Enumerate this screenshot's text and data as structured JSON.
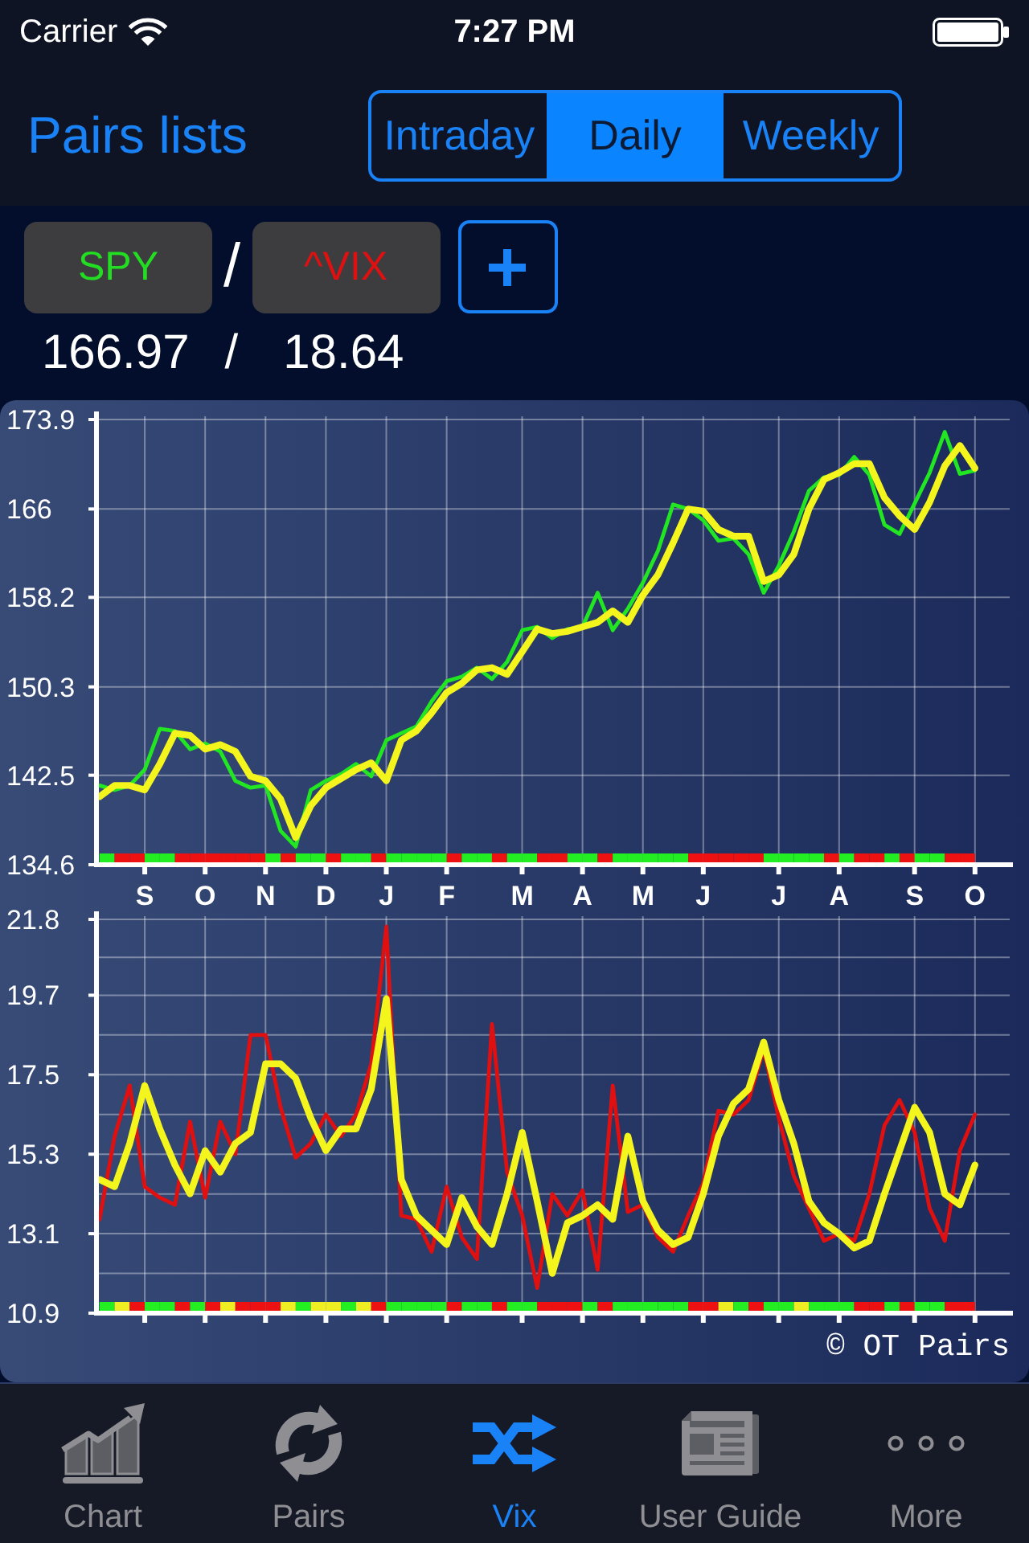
{
  "status_bar": {
    "carrier": "Carrier",
    "time": "7:27 PM"
  },
  "nav_bar": {
    "title": "Pairs lists",
    "segments": [
      {
        "label": "Intraday",
        "selected": false
      },
      {
        "label": "Daily",
        "selected": true
      },
      {
        "label": "Weekly",
        "selected": false
      }
    ]
  },
  "pair": {
    "symbols": [
      {
        "label": "SPY",
        "color": "#22dd22"
      },
      {
        "label": "^VIX",
        "color": "#e01010"
      }
    ],
    "separator": "/",
    "prices": [
      "166.97",
      "18.64"
    ],
    "price_separator": "/"
  },
  "charts": [
    {
      "chart_data": {
        "type": "line",
        "grid": true,
        "categories": [
          null,
          null,
          null,
          "S",
          null,
          null,
          null,
          "O",
          null,
          null,
          null,
          "N",
          null,
          null,
          null,
          "D",
          null,
          null,
          null,
          "J",
          null,
          null,
          null,
          "F",
          null,
          null,
          null,
          null,
          "M",
          null,
          null,
          null,
          "A",
          null,
          null,
          null,
          "M",
          null,
          null,
          null,
          "J",
          null,
          null,
          null,
          null,
          "J",
          null,
          null,
          null,
          "A",
          null,
          null,
          null,
          null,
          "S",
          null,
          null,
          null,
          "O"
        ],
        "ylim": [
          134.6,
          173.9
        ],
        "yticks": [
          134.6,
          142.5,
          150.3,
          158.2,
          166,
          173.9
        ],
        "series": [
          {
            "color": "#22e622",
            "values": [
              141.6,
              141.2,
              141.6,
              143.0,
              146.6,
              146.4,
              144.8,
              145.3,
              144.6,
              142.0,
              141.4,
              141.6,
              137.6,
              136.2,
              141.2,
              142.0,
              142.6,
              143.5,
              142.4,
              145.6,
              146.2,
              146.8,
              149.0,
              150.8,
              151.2,
              152.0,
              151.0,
              152.5,
              155.3,
              155.6,
              154.6,
              155.4,
              155.6,
              158.6,
              155.3,
              157.2,
              159.5,
              162.3,
              166.4,
              166.0,
              165.0,
              163.2,
              163.4,
              162.0,
              158.6,
              161.0,
              164.0,
              167.6,
              168.8,
              169.0,
              170.6,
              169.0,
              164.6,
              163.8,
              166.5,
              169.2,
              172.8,
              169.1,
              169.4
            ]
          },
          {
            "color": "#f5f51e",
            "values": [
              140.6,
              141.6,
              141.6,
              141.2,
              143.5,
              146.2,
              146.0,
              144.8,
              145.2,
              144.6,
              142.4,
              142.0,
              140.4,
              137.0,
              139.8,
              141.4,
              142.2,
              143.0,
              143.6,
              142.0,
              145.6,
              146.4,
              148.0,
              149.8,
              150.6,
              151.8,
              152.0,
              151.4,
              153.4,
              155.4,
              155.0,
              155.2,
              155.6,
              156.0,
              157.0,
              156.0,
              158.4,
              160.2,
              163.0,
              166.0,
              165.8,
              164.2,
              163.6,
              163.6,
              159.6,
              160.2,
              162.0,
              166.0,
              168.6,
              169.2,
              170.0,
              170.0,
              167.0,
              165.4,
              164.2,
              166.6,
              169.8,
              171.6,
              169.6
            ]
          }
        ]
      },
      "signal_strip": [
        {
          "color": "#22ee22"
        },
        {
          "color": "#ee1111"
        },
        {
          "color": "#ee1111"
        },
        {
          "color": "#22ee22"
        },
        {
          "color": "#22ee22"
        },
        {
          "color": "#ee1111"
        },
        {
          "color": "#ee1111"
        },
        {
          "color": "#ee1111"
        },
        {
          "color": "#ee1111"
        },
        {
          "color": "#ee1111"
        },
        {
          "color": "#ee1111"
        },
        {
          "color": "#22ee22"
        },
        {
          "color": "#ee1111"
        },
        {
          "color": "#22ee22"
        },
        {
          "color": "#22ee22"
        },
        {
          "color": "#ee1111"
        },
        {
          "color": "#22ee22"
        },
        {
          "color": "#22ee22"
        },
        {
          "color": "#ee1111"
        },
        {
          "color": "#22ee22"
        },
        {
          "color": "#22ee22"
        },
        {
          "color": "#22ee22"
        },
        {
          "color": "#22ee22"
        },
        {
          "color": "#ee1111"
        },
        {
          "color": "#22ee22"
        },
        {
          "color": "#22ee22"
        },
        {
          "color": "#ee1111"
        },
        {
          "color": "#22ee22"
        },
        {
          "color": "#22ee22"
        },
        {
          "color": "#ee1111"
        },
        {
          "color": "#ee1111"
        },
        {
          "color": "#22ee22"
        },
        {
          "color": "#22ee22"
        },
        {
          "color": "#ee1111"
        },
        {
          "color": "#22ee22"
        },
        {
          "color": "#22ee22"
        },
        {
          "color": "#22ee22"
        },
        {
          "color": "#22ee22"
        },
        {
          "color": "#22ee22"
        },
        {
          "color": "#ee1111"
        },
        {
          "color": "#ee1111"
        },
        {
          "color": "#ee1111"
        },
        {
          "color": "#ee1111"
        },
        {
          "color": "#ee1111"
        },
        {
          "color": "#22ee22"
        },
        {
          "color": "#22ee22"
        },
        {
          "color": "#22ee22"
        },
        {
          "color": "#22ee22"
        },
        {
          "color": "#ee1111"
        },
        {
          "color": "#22ee22"
        },
        {
          "color": "#ee1111"
        },
        {
          "color": "#ee1111"
        },
        {
          "color": "#22ee22"
        },
        {
          "color": "#ee1111"
        },
        {
          "color": "#22ee22"
        },
        {
          "color": "#22ee22"
        },
        {
          "color": "#ee1111"
        },
        {
          "color": "#ee1111"
        }
      ]
    },
    {
      "chart_data": {
        "type": "line",
        "grid": true,
        "ylim": [
          10.9,
          21.8
        ],
        "yticks": [
          10.9,
          13.1,
          15.3,
          17.5,
          19.7,
          21.8
        ],
        "series": [
          {
            "color": "#e01010",
            "values": [
              13.5,
              15.8,
              17.2,
              14.4,
              14.1,
              13.9,
              16.2,
              14.1,
              16.2,
              15.3,
              18.6,
              18.6,
              16.6,
              15.2,
              15.6,
              16.4,
              15.8,
              16.4,
              17.8,
              21.6,
              13.6,
              13.5,
              12.6,
              14.4,
              13.0,
              12.4,
              18.9,
              14.8,
              13.6,
              11.6,
              14.2,
              13.6,
              14.3,
              12.1,
              17.2,
              13.7,
              13.9,
              13.0,
              12.6,
              13.6,
              14.5,
              16.5,
              16.4,
              16.8,
              18.2,
              16.3,
              14.7,
              13.8,
              12.9,
              13.1,
              12.9,
              14.2,
              16.1,
              16.8,
              15.9,
              13.8,
              12.9,
              15.4,
              16.4
            ]
          },
          {
            "color": "#f5f51e",
            "values": [
              14.6,
              14.4,
              15.6,
              17.2,
              16.0,
              15.0,
              14.2,
              15.4,
              14.8,
              15.6,
              15.9,
              17.8,
              17.8,
              17.4,
              16.3,
              15.4,
              16.0,
              16.0,
              17.1,
              19.6,
              14.6,
              13.6,
              13.2,
              12.8,
              14.1,
              13.3,
              12.8,
              14.2,
              15.9,
              14.0,
              12.0,
              13.4,
              13.6,
              13.9,
              13.5,
              15.8,
              14.0,
              13.2,
              12.8,
              13.0,
              14.2,
              15.8,
              16.7,
              17.1,
              18.4,
              16.8,
              15.6,
              14.0,
              13.4,
              13.1,
              12.7,
              12.9,
              14.2,
              15.4,
              16.6,
              15.9,
              14.2,
              13.9,
              15.0
            ]
          }
        ]
      },
      "minor_grid": true,
      "signal_strip": [
        {
          "color": "#22ee22"
        },
        {
          "color": "#eeee22"
        },
        {
          "color": "#ee1111"
        },
        {
          "color": "#22ee22"
        },
        {
          "color": "#22ee22"
        },
        {
          "color": "#ee1111"
        },
        {
          "color": "#22ee22"
        },
        {
          "color": "#ee1111"
        },
        {
          "color": "#eeee22"
        },
        {
          "color": "#ee1111"
        },
        {
          "color": "#ee1111"
        },
        {
          "color": "#ee1111"
        },
        {
          "color": "#eeee22"
        },
        {
          "color": "#22ee22"
        },
        {
          "color": "#eeee22"
        },
        {
          "color": "#eeee22"
        },
        {
          "color": "#22ee22"
        },
        {
          "color": "#eeee22"
        },
        {
          "color": "#ee1111"
        },
        {
          "color": "#22ee22"
        },
        {
          "color": "#22ee22"
        },
        {
          "color": "#22ee22"
        },
        {
          "color": "#22ee22"
        },
        {
          "color": "#ee1111"
        },
        {
          "color": "#22ee22"
        },
        {
          "color": "#22ee22"
        },
        {
          "color": "#ee1111"
        },
        {
          "color": "#22ee22"
        },
        {
          "color": "#22ee22"
        },
        {
          "color": "#ee1111"
        },
        {
          "color": "#ee1111"
        },
        {
          "color": "#ee1111"
        },
        {
          "color": "#22ee22"
        },
        {
          "color": "#ee1111"
        },
        {
          "color": "#22ee22"
        },
        {
          "color": "#22ee22"
        },
        {
          "color": "#22ee22"
        },
        {
          "color": "#22ee22"
        },
        {
          "color": "#22ee22"
        },
        {
          "color": "#ee1111"
        },
        {
          "color": "#ee1111"
        },
        {
          "color": "#eeee22"
        },
        {
          "color": "#22ee22"
        },
        {
          "color": "#ee1111"
        },
        {
          "color": "#22ee22"
        },
        {
          "color": "#22ee22"
        },
        {
          "color": "#eeee22"
        },
        {
          "color": "#22ee22"
        },
        {
          "color": "#22ee22"
        },
        {
          "color": "#22ee22"
        },
        {
          "color": "#ee1111"
        },
        {
          "color": "#ee1111"
        },
        {
          "color": "#22ee22"
        },
        {
          "color": "#ee1111"
        },
        {
          "color": "#22ee22"
        },
        {
          "color": "#22ee22"
        },
        {
          "color": "#ee1111"
        },
        {
          "color": "#ee1111"
        }
      ]
    }
  ],
  "copyright": "© OT Pairs",
  "tab_bar": [
    {
      "label": "Chart",
      "selected": false
    },
    {
      "label": "Pairs",
      "selected": false
    },
    {
      "label": "Vix",
      "selected": true
    },
    {
      "label": "User Guide",
      "selected": false
    },
    {
      "label": "More",
      "selected": false
    }
  ]
}
